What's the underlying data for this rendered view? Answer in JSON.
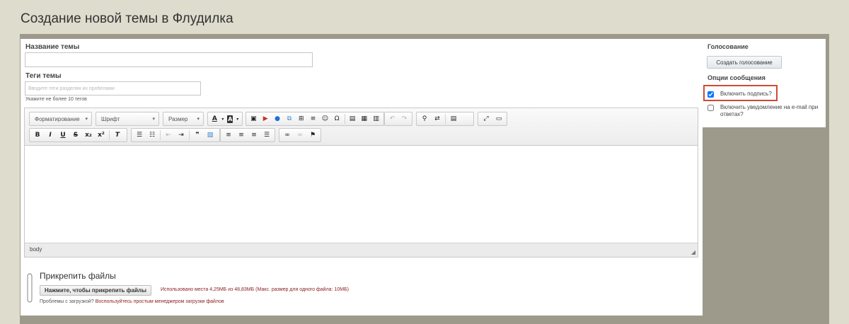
{
  "page": {
    "title": "Создание новой темы в Флудилка"
  },
  "form": {
    "topic_name_label": "Название темы",
    "topic_name_value": "",
    "tags_label": "Теги темы",
    "tags_placeholder": "Вводите теги разделяя их пробелами",
    "tags_hint": "Укажите не более 10 тегов"
  },
  "editor": {
    "format_label": "Форматирование",
    "font_label": "Шрифт",
    "size_label": "Размер",
    "status_path": "body"
  },
  "attach": {
    "title": "Прикрепить файлы",
    "button": "Нажмите, чтобы прикрепить файлы",
    "usage": "Использовано места 4,25МБ из 48,83МБ (Макс. размер для одного файла: 10МБ)",
    "problems_text": "Проблемы с загрузкой?",
    "problems_link": "Воспользуйтесь простым менеджером загрузки файлов"
  },
  "sidebar": {
    "poll_heading": "Голосование",
    "poll_button": "Создать голосование",
    "options_heading": "Опции сообщения",
    "signature_label": "Включить подпись?",
    "signature_checked": true,
    "notify_label": "Включить уведомление на e-mail при ответах?",
    "notify_checked": false
  },
  "colors": {
    "page_bg": "#dedccd",
    "frame_bg": "#9e9a8b",
    "accent_red": "#8b1c1c",
    "highlight_border": "#d04a35"
  }
}
